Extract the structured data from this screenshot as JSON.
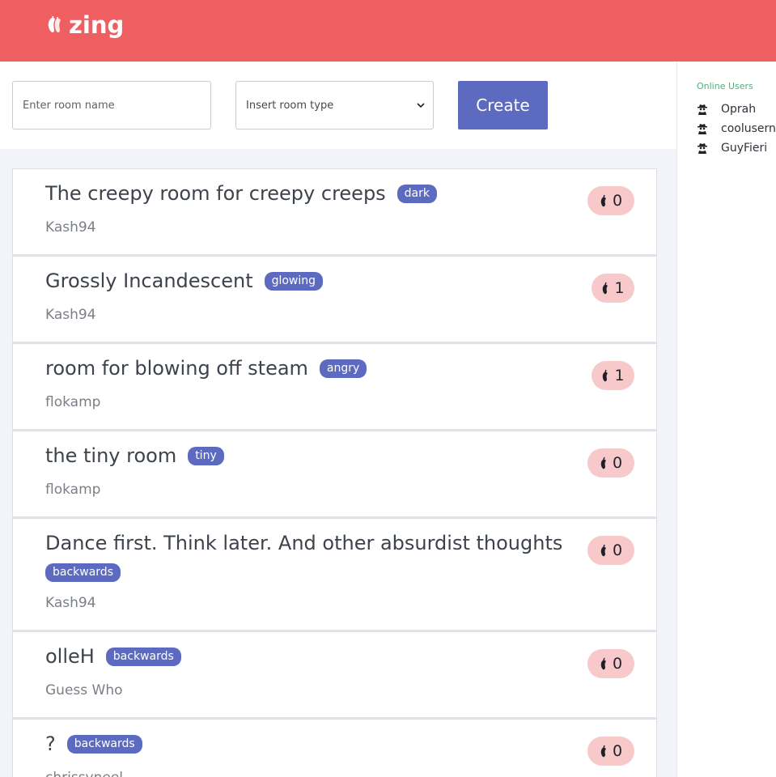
{
  "app": {
    "name": "zing"
  },
  "create_form": {
    "room_name_placeholder": "Enter room name",
    "room_type_selected": "Insert room type",
    "create_label": "Create"
  },
  "sidebar": {
    "title": "Online Users",
    "users": [
      "Oprah",
      "coolusern",
      "GuyFieri"
    ]
  },
  "rooms": [
    {
      "title": "The creepy room for creepy creeps",
      "tag": "dark",
      "owner": "Kash94",
      "count": "0"
    },
    {
      "title": "Grossly Incandescent",
      "tag": "glowing",
      "owner": "Kash94",
      "count": "1"
    },
    {
      "title": "room for blowing off steam",
      "tag": "angry",
      "owner": "flokamp",
      "count": "1"
    },
    {
      "title": "the tiny room",
      "tag": "tiny",
      "owner": "flokamp",
      "count": "0"
    },
    {
      "title": "Dance first. Think later. And other absurdist thoughts",
      "tag": "backwards",
      "owner": "Kash94",
      "count": "0"
    },
    {
      "title": "olleH",
      "tag": "backwards",
      "owner": "Guess Who",
      "count": "0"
    },
    {
      "title": "?",
      "tag": "backwards",
      "owner": "chrissyneel",
      "count": "0"
    }
  ],
  "colors": {
    "header": "#ef5f62",
    "accent": "#5c6bc0",
    "badge": "#f8c9cb",
    "online_title": "#4caf7e"
  },
  "icons": {
    "brand": "zing-logo-icon",
    "user": "spy-user-icon",
    "count": "pepper-icon",
    "select": "chevron-down-icon"
  }
}
